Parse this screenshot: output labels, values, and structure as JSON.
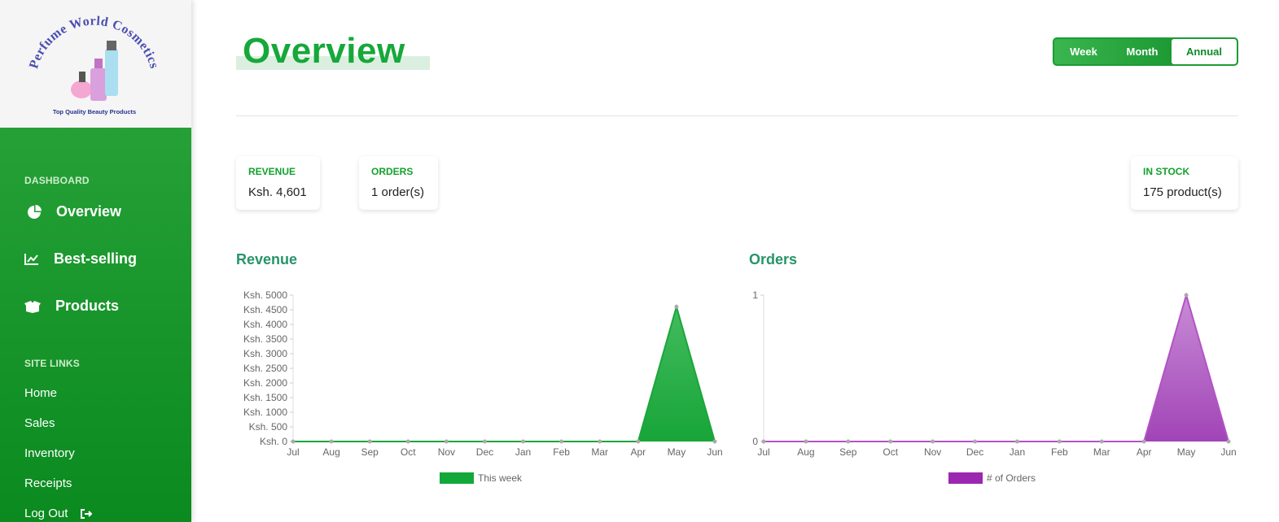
{
  "brand": {
    "name": "Perfume World Cosmetics",
    "tagline": "Top Quality Beauty Products"
  },
  "sidebar": {
    "dashboard_label": "DASHBOARD",
    "nav": [
      {
        "label": "Overview",
        "icon": "pie-chart-icon"
      },
      {
        "label": "Best-selling",
        "icon": "line-chart-icon"
      },
      {
        "label": "Products",
        "icon": "boxes-icon"
      }
    ],
    "site_links_label": "SITE LINKS",
    "links": [
      {
        "label": "Home"
      },
      {
        "label": "Sales"
      },
      {
        "label": "Inventory"
      },
      {
        "label": "Receipts"
      },
      {
        "label": "Log Out",
        "icon": "logout-icon"
      }
    ]
  },
  "header": {
    "title": "Overview",
    "periods": [
      "Week",
      "Month",
      "Annual"
    ],
    "active_period": "Annual"
  },
  "stats": {
    "revenue": {
      "label": "REVENUE",
      "value": "Ksh. 4,601"
    },
    "orders": {
      "label": "ORDERS",
      "value": "1 order(s)"
    },
    "stock": {
      "label": "IN STOCK",
      "value": "175 product(s)"
    }
  },
  "colors": {
    "brand_green": "#16a83a",
    "revenue_fill": "#2fb24e",
    "orders_fill": "#b05fc2",
    "orders_legend": "#9c27b0"
  },
  "chart_data": [
    {
      "type": "area",
      "title": "Revenue",
      "categories": [
        "Jul",
        "Aug",
        "Sep",
        "Oct",
        "Nov",
        "Dec",
        "Jan",
        "Feb",
        "Mar",
        "Apr",
        "May",
        "Jun"
      ],
      "series": [
        {
          "name": "This week",
          "values": [
            0,
            0,
            0,
            0,
            0,
            0,
            0,
            0,
            0,
            0,
            4601,
            0
          ]
        }
      ],
      "ylim": [
        0,
        5000
      ],
      "yticks": [
        "Ksh. 5000",
        "Ksh. 4500",
        "Ksh. 4000",
        "Ksh. 3500",
        "Ksh. 3000",
        "Ksh. 2500",
        "Ksh. 2000",
        "Ksh. 1500",
        "Ksh. 1000",
        "Ksh. 500",
        "Ksh. 0"
      ],
      "legend": "bottom"
    },
    {
      "type": "area",
      "title": "Orders",
      "categories": [
        "Jul",
        "Aug",
        "Sep",
        "Oct",
        "Nov",
        "Dec",
        "Jan",
        "Feb",
        "Mar",
        "Apr",
        "May",
        "Jun"
      ],
      "series": [
        {
          "name": "# of Orders",
          "values": [
            0,
            0,
            0,
            0,
            0,
            0,
            0,
            0,
            0,
            0,
            1,
            0
          ]
        }
      ],
      "ylim": [
        0,
        1
      ],
      "yticks": [
        "1",
        "0"
      ],
      "legend": "bottom"
    }
  ]
}
